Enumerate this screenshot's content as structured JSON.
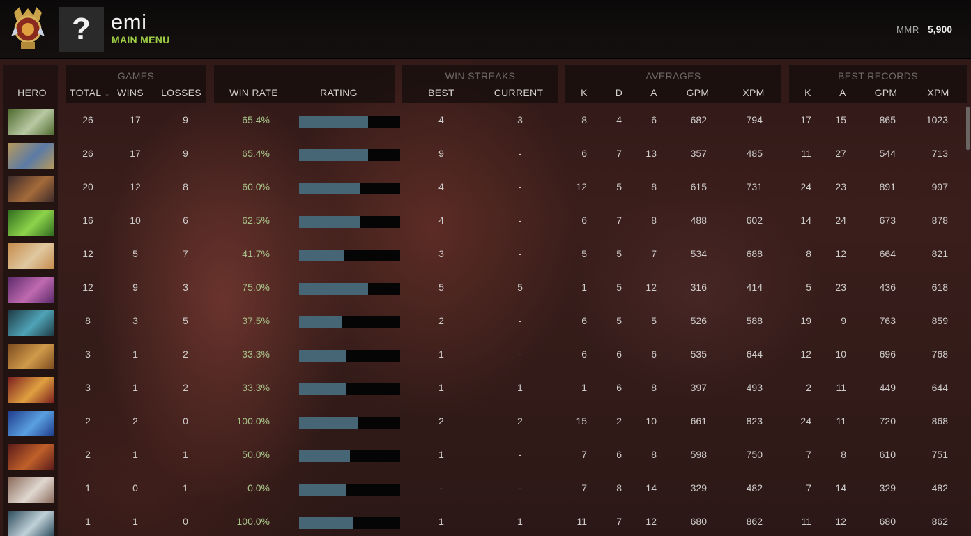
{
  "profile": {
    "username": "emi",
    "subtitle": "MAIN MENU",
    "avatar_placeholder": "?",
    "mmr_label": "MMR",
    "mmr_value": "5,900",
    "medal_icon": "ancient-rank-medal-icon"
  },
  "colors": {
    "accent_green": "#9ccc45",
    "rating_bar": "#476675",
    "winrate_text": "#a9c38a"
  },
  "groups": {
    "games": "GAMES",
    "win_streaks": "WIN STREAKS",
    "averages": "AVERAGES",
    "best_records": "BEST RECORDS"
  },
  "columns": {
    "hero": "HERO",
    "total": "TOTAL",
    "total_sort_icon": "chevron-down-icon",
    "wins": "WINS",
    "losses": "LOSSES",
    "win_rate": "WIN RATE",
    "rating": "RATING",
    "streak_best": "BEST",
    "streak_current": "CURRENT",
    "avg_k": "K",
    "avg_d": "D",
    "avg_a": "A",
    "avg_gpm": "GPM",
    "avg_xpm": "XPM",
    "best_k": "K",
    "best_a": "A",
    "best_gpm": "GPM",
    "best_xpm": "XPM"
  },
  "rows": [
    {
      "total": "26",
      "wins": "17",
      "losses": "9",
      "win_rate": "65.4%",
      "rating": 0.68,
      "streak_best": "4",
      "streak_current": "3",
      "k": "8",
      "d": "4",
      "a": "6",
      "gpm": "682",
      "xpm": "794",
      "best_k": "17",
      "best_a": "15",
      "best_gpm": "865",
      "best_xpm": "1023"
    },
    {
      "total": "26",
      "wins": "17",
      "losses": "9",
      "win_rate": "65.4%",
      "rating": 0.68,
      "streak_best": "9",
      "streak_current": "-",
      "k": "6",
      "d": "7",
      "a": "13",
      "gpm": "357",
      "xpm": "485",
      "best_k": "11",
      "best_a": "27",
      "best_gpm": "544",
      "best_xpm": "713"
    },
    {
      "total": "20",
      "wins": "12",
      "losses": "8",
      "win_rate": "60.0%",
      "rating": 0.6,
      "streak_best": "4",
      "streak_current": "-",
      "k": "12",
      "d": "5",
      "a": "8",
      "gpm": "615",
      "xpm": "731",
      "best_k": "24",
      "best_a": "23",
      "best_gpm": "891",
      "best_xpm": "997"
    },
    {
      "total": "16",
      "wins": "10",
      "losses": "6",
      "win_rate": "62.5%",
      "rating": 0.61,
      "streak_best": "4",
      "streak_current": "-",
      "k": "6",
      "d": "7",
      "a": "8",
      "gpm": "488",
      "xpm": "602",
      "best_k": "14",
      "best_a": "24",
      "best_gpm": "673",
      "best_xpm": "878"
    },
    {
      "total": "12",
      "wins": "5",
      "losses": "7",
      "win_rate": "41.7%",
      "rating": 0.44,
      "streak_best": "3",
      "streak_current": "-",
      "k": "5",
      "d": "5",
      "a": "7",
      "gpm": "534",
      "xpm": "688",
      "best_k": "8",
      "best_a": "12",
      "best_gpm": "664",
      "best_xpm": "821"
    },
    {
      "total": "12",
      "wins": "9",
      "losses": "3",
      "win_rate": "75.0%",
      "rating": 0.68,
      "streak_best": "5",
      "streak_current": "5",
      "k": "1",
      "d": "5",
      "a": "12",
      "gpm": "316",
      "xpm": "414",
      "best_k": "5",
      "best_a": "23",
      "best_gpm": "436",
      "best_xpm": "618"
    },
    {
      "total": "8",
      "wins": "3",
      "losses": "5",
      "win_rate": "37.5%",
      "rating": 0.43,
      "streak_best": "2",
      "streak_current": "-",
      "k": "6",
      "d": "5",
      "a": "5",
      "gpm": "526",
      "xpm": "588",
      "best_k": "19",
      "best_a": "9",
      "best_gpm": "763",
      "best_xpm": "859"
    },
    {
      "total": "3",
      "wins": "1",
      "losses": "2",
      "win_rate": "33.3%",
      "rating": 0.47,
      "streak_best": "1",
      "streak_current": "-",
      "k": "6",
      "d": "6",
      "a": "6",
      "gpm": "535",
      "xpm": "644",
      "best_k": "12",
      "best_a": "10",
      "best_gpm": "696",
      "best_xpm": "768"
    },
    {
      "total": "3",
      "wins": "1",
      "losses": "2",
      "win_rate": "33.3%",
      "rating": 0.47,
      "streak_best": "1",
      "streak_current": "1",
      "k": "1",
      "d": "6",
      "a": "8",
      "gpm": "397",
      "xpm": "493",
      "best_k": "2",
      "best_a": "11",
      "best_gpm": "449",
      "best_xpm": "644"
    },
    {
      "total": "2",
      "wins": "2",
      "losses": "0",
      "win_rate": "100.0%",
      "rating": 0.58,
      "streak_best": "2",
      "streak_current": "2",
      "k": "15",
      "d": "2",
      "a": "10",
      "gpm": "661",
      "xpm": "823",
      "best_k": "24",
      "best_a": "11",
      "best_gpm": "720",
      "best_xpm": "868"
    },
    {
      "total": "2",
      "wins": "1",
      "losses": "1",
      "win_rate": "50.0%",
      "rating": 0.5,
      "streak_best": "1",
      "streak_current": "-",
      "k": "7",
      "d": "6",
      "a": "8",
      "gpm": "598",
      "xpm": "750",
      "best_k": "7",
      "best_a": "8",
      "best_gpm": "610",
      "best_xpm": "751"
    },
    {
      "total": "1",
      "wins": "0",
      "losses": "1",
      "win_rate": "0.0%",
      "rating": 0.46,
      "streak_best": "-",
      "streak_current": "-",
      "k": "7",
      "d": "8",
      "a": "14",
      "gpm": "329",
      "xpm": "482",
      "best_k": "7",
      "best_a": "14",
      "best_gpm": "329",
      "best_xpm": "482"
    },
    {
      "total": "1",
      "wins": "1",
      "losses": "0",
      "win_rate": "100.0%",
      "rating": 0.54,
      "streak_best": "1",
      "streak_current": "1",
      "k": "11",
      "d": "7",
      "a": "12",
      "gpm": "680",
      "xpm": "862",
      "best_k": "11",
      "best_a": "12",
      "best_gpm": "680",
      "best_xpm": "862"
    }
  ],
  "hero_portraits": [
    {
      "icon": "hero-portrait-icon",
      "c1": "#4d6a2e",
      "c2": "#b9c9a2"
    },
    {
      "icon": "hero-portrait-icon",
      "c1": "#b89a5a",
      "c2": "#5b7aa6"
    },
    {
      "icon": "hero-portrait-icon",
      "c1": "#3b2a2a",
      "c2": "#a46a3a"
    },
    {
      "icon": "hero-portrait-icon",
      "c1": "#2f6b1f",
      "c2": "#8ed34a"
    },
    {
      "icon": "hero-portrait-icon",
      "c1": "#c58b4c",
      "c2": "#e0c8a0"
    },
    {
      "icon": "hero-portrait-icon",
      "c1": "#5a2a6a",
      "c2": "#c06ab0"
    },
    {
      "icon": "hero-portrait-icon",
      "c1": "#1e3a44",
      "c2": "#4fa3b7"
    },
    {
      "icon": "hero-portrait-icon",
      "c1": "#7a4a1e",
      "c2": "#d09a4a"
    },
    {
      "icon": "hero-portrait-icon",
      "c1": "#7a1e1e",
      "c2": "#e0a040"
    },
    {
      "icon": "hero-portrait-icon",
      "c1": "#1e3a8a",
      "c2": "#5aa0e0"
    },
    {
      "icon": "hero-portrait-icon",
      "c1": "#5a1a1a",
      "c2": "#c0602a"
    },
    {
      "icon": "hero-portrait-icon",
      "c1": "#8a6a5a",
      "c2": "#e0d8d0"
    },
    {
      "icon": "hero-portrait-icon",
      "c1": "#2a4a5a",
      "c2": "#c0d0d8"
    }
  ]
}
